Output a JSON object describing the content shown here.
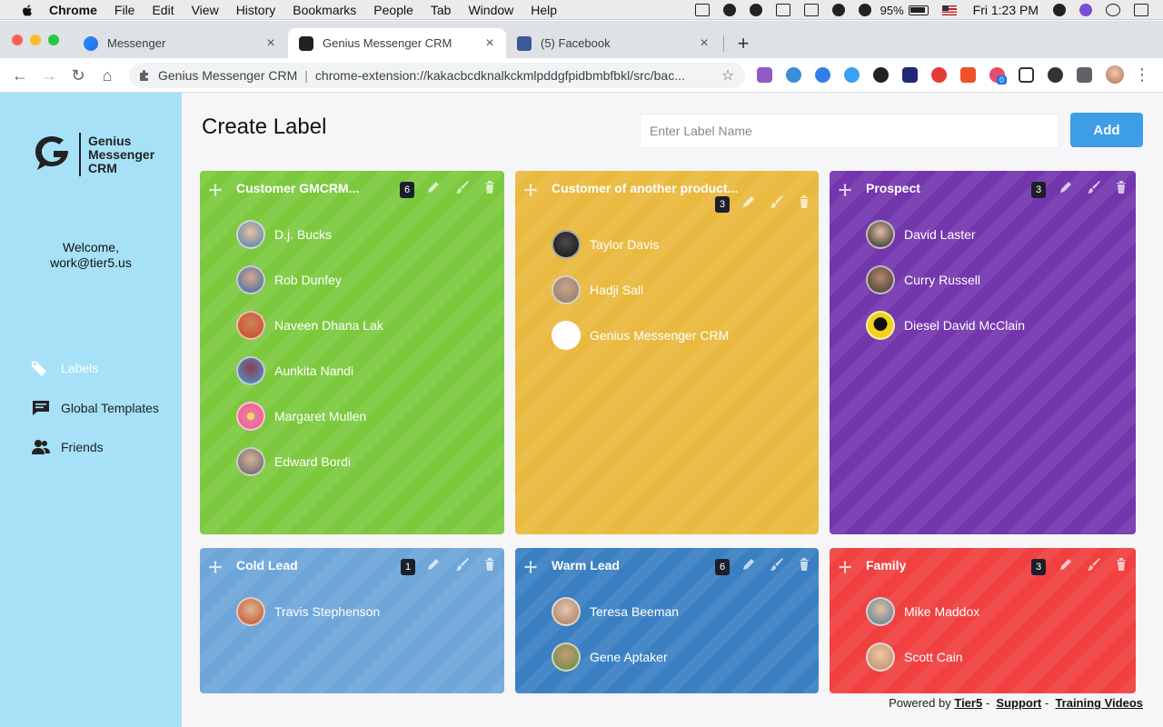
{
  "menubar": {
    "items": [
      "Chrome",
      "File",
      "Edit",
      "View",
      "History",
      "Bookmarks",
      "People",
      "Tab",
      "Window",
      "Help"
    ],
    "battery": "95%",
    "clock": "Fri 1:23 PM"
  },
  "tabs": [
    {
      "title": "Messenger",
      "close": "×"
    },
    {
      "title": "Genius Messenger CRM",
      "close": "×"
    },
    {
      "title": "(5) Facebook",
      "close": "×"
    }
  ],
  "new_tab": "+",
  "toolbar": {
    "back": "←",
    "forward": "→",
    "reload": "↻",
    "home": "⌂",
    "site_name": "Genius Messenger CRM",
    "separator": "|",
    "url": "chrome-extension://kakacbcdknalkckmlpddgfpidbmbfbkl/src/bac...",
    "star": "☆",
    "menu": "⋮",
    "badge": "0"
  },
  "sidebar": {
    "brand_lines": [
      "Genius",
      "Messenger",
      "CRM"
    ],
    "welcome_line1": "Welcome,",
    "welcome_line2": "work@tier5.us",
    "nav": [
      {
        "label": "Labels",
        "icon": "tag-icon",
        "active": true
      },
      {
        "label": "Global Templates",
        "icon": "chat-icon",
        "active": false
      },
      {
        "label": "Friends",
        "icon": "users-icon",
        "active": false
      }
    ]
  },
  "main": {
    "title": "Create Label",
    "input_placeholder": "Enter Label Name",
    "add_label": "Add"
  },
  "colors": {
    "green": "#7cc93e",
    "yellow": "#eab93f",
    "purple": "#7336ad",
    "lightblue": "#6ea6da",
    "blue": "#3a7fc2",
    "red": "#f0403f",
    "sidebar": "#a6e1f8",
    "accent": "#3d9de6"
  },
  "labels": [
    {
      "name": "Customer GMCRM...",
      "count": "6",
      "color": "green",
      "friends": [
        "D.j. Bucks",
        "Rob Dunfey",
        "Naveen Dhana Lak",
        "Aunkita Nandi",
        "Margaret Mullen",
        "Edward Bordi"
      ]
    },
    {
      "name": "Customer of another product...",
      "count": "3",
      "color": "yellow",
      "friends": [
        "Taylor Davis",
        "Hadji Sall",
        "Genius Messenger CRM"
      ]
    },
    {
      "name": "Prospect",
      "count": "3",
      "color": "purple",
      "friends": [
        "David Laster",
        "Curry Russell",
        "Diesel David McClain"
      ]
    },
    {
      "name": "Cold Lead",
      "count": "1",
      "color": "lightblue",
      "friends": [
        "Travis Stephenson"
      ]
    },
    {
      "name": "Warm Lead",
      "count": "6",
      "color": "blue",
      "friends": [
        "Teresa Beeman",
        "Gene Aptaker"
      ]
    },
    {
      "name": "Family",
      "count": "3",
      "color": "red",
      "friends": [
        "Mike Maddox",
        "Scott Cain"
      ]
    }
  ],
  "footer": {
    "powered_by": "Powered by",
    "tier5": "Tier5",
    "dash": "-",
    "support": "Support",
    "training": "Training Videos"
  }
}
